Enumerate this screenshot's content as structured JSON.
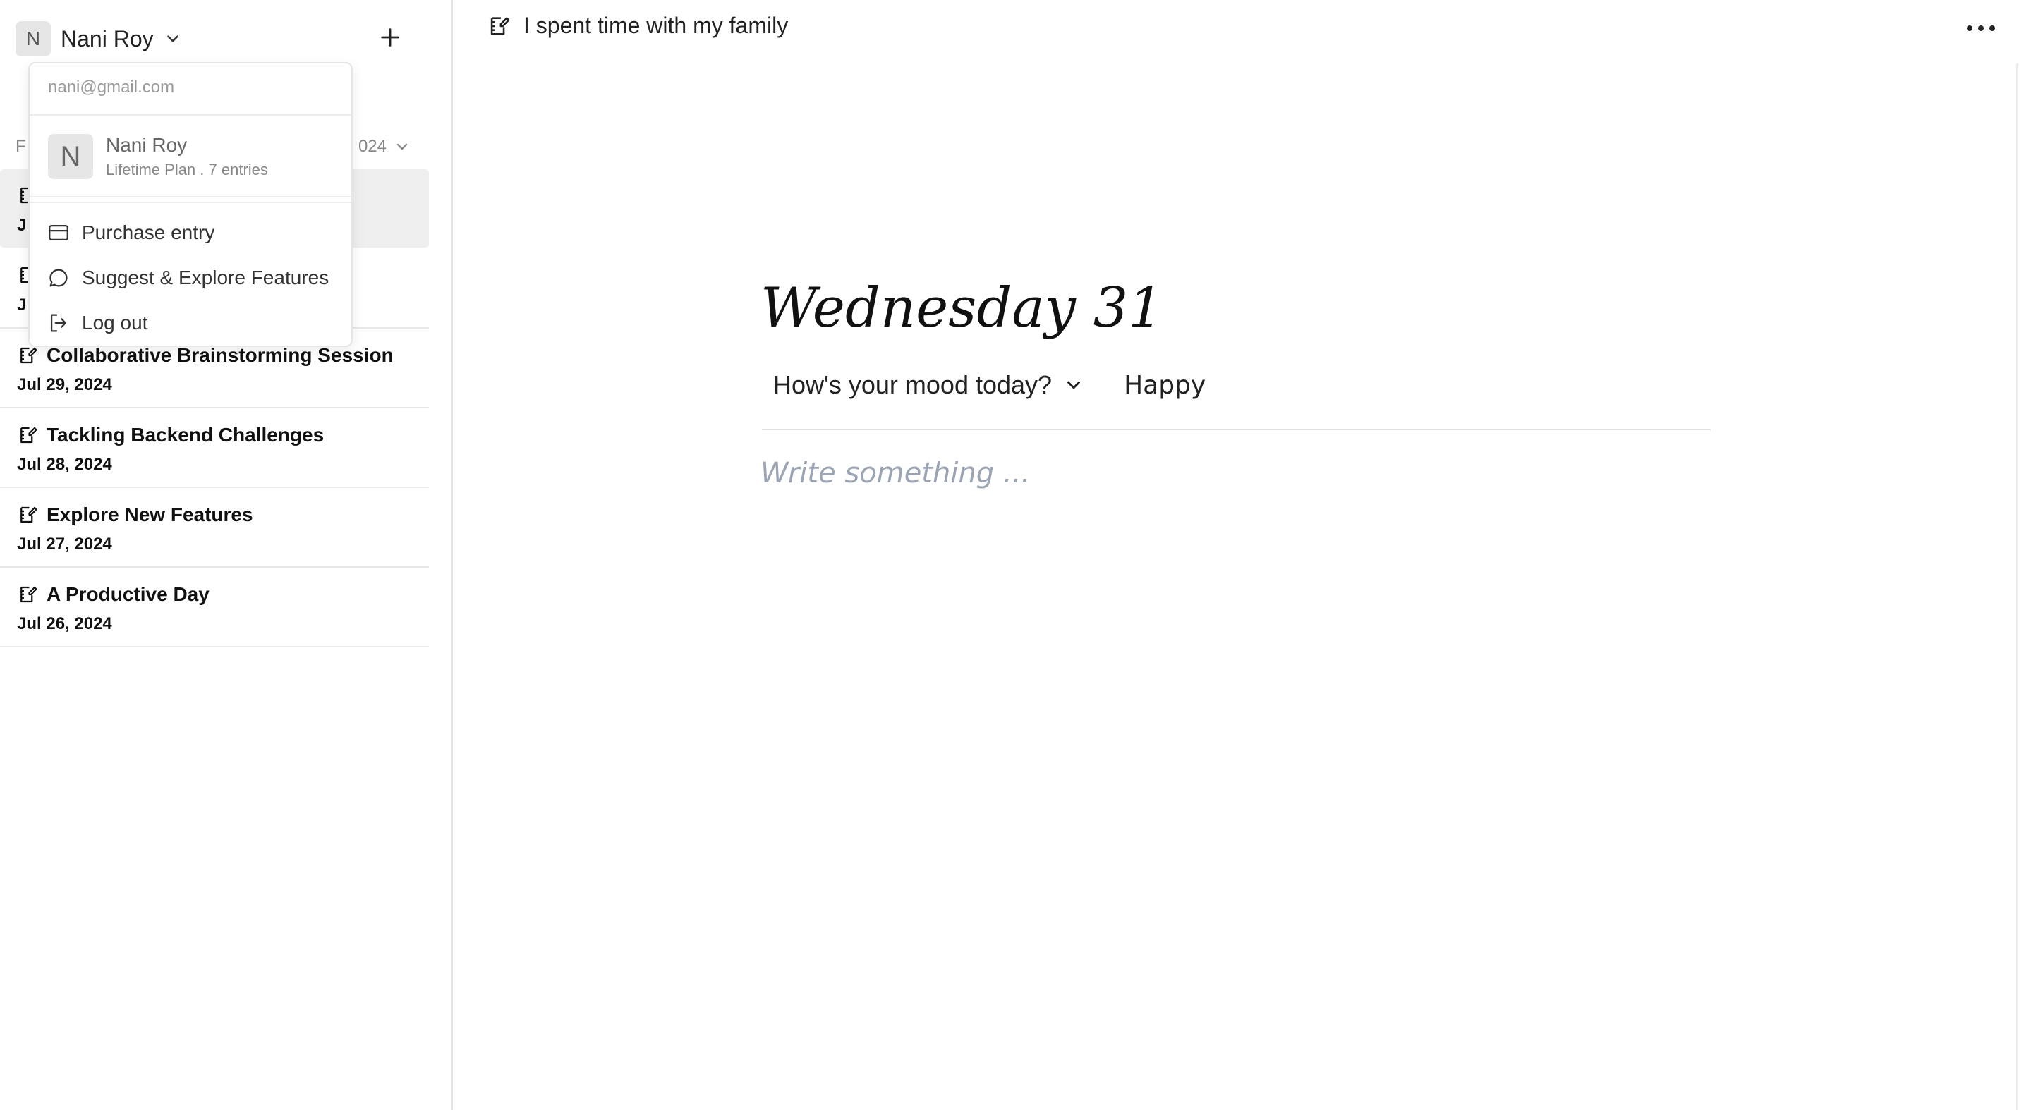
{
  "sidebar": {
    "user": {
      "initial": "N",
      "name": "Nani Roy"
    },
    "filter": {
      "left_label": "F",
      "right_label": "024"
    },
    "entries": [
      {
        "title": "",
        "date": "J"
      },
      {
        "title": "",
        "date": "J"
      },
      {
        "title": "Collaborative Brainstorming Session",
        "date": "Jul 29, 2024"
      },
      {
        "title": "Tackling Backend Challenges",
        "date": "Jul 28, 2024"
      },
      {
        "title": "Explore New Features",
        "date": "Jul 27, 2024"
      },
      {
        "title": "A Productive Day",
        "date": "Jul 26, 2024"
      }
    ]
  },
  "dropdown": {
    "email": "nani@gmail.com",
    "user_initial": "N",
    "user_name": "Nani Roy",
    "plan": "Lifetime Plan . 7 entries",
    "items": [
      {
        "label": "Purchase entry",
        "icon": "credit-card-icon"
      },
      {
        "label": "Suggest & Explore Features",
        "icon": "chat-bubble-icon"
      },
      {
        "label": "Log out",
        "icon": "logout-icon"
      }
    ]
  },
  "topbar": {
    "title": "I spent time with my family"
  },
  "main": {
    "day_heading": "Wednesday 31",
    "mood_prompt": "How's your mood today?",
    "mood_value": "Happy",
    "editor_placeholder": "Write something ..."
  }
}
